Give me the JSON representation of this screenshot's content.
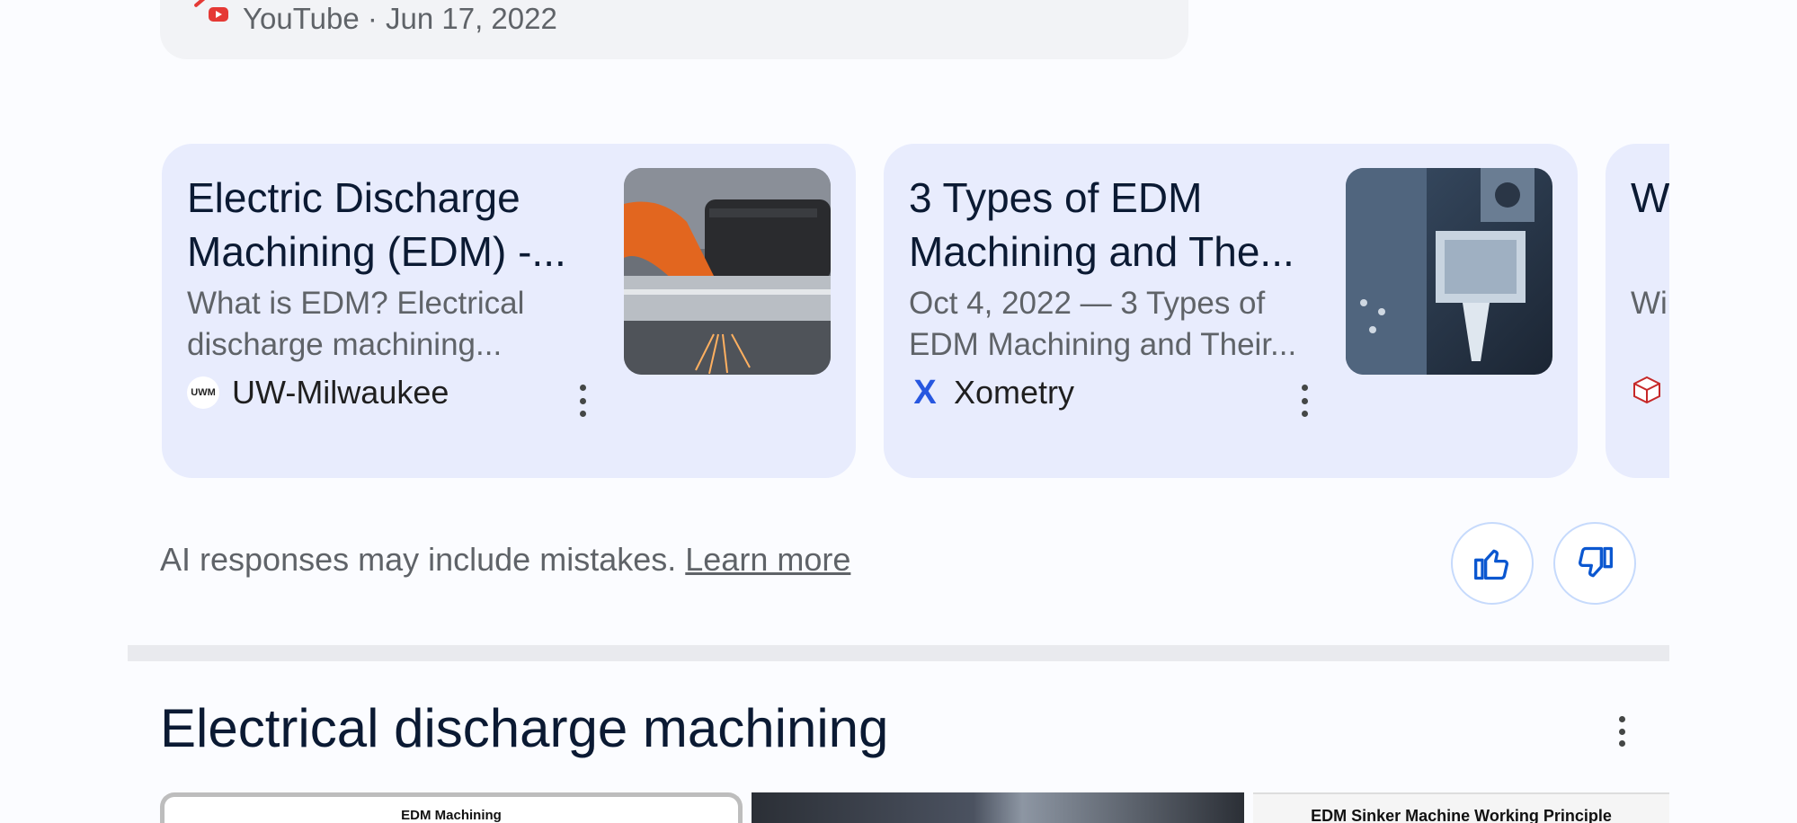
{
  "video": {
    "source": "YouTube",
    "date": "Jun 17, 2022",
    "meta": "YouTube · Jun 17, 2022"
  },
  "cards": [
    {
      "title": "Electric Discharge Machining (EDM) -...",
      "snippet": "What is EDM? Electrical discharge machining...",
      "source": "UW-Milwaukee",
      "source_icon": "UWM"
    },
    {
      "title": "3 Types of EDM Machining and The...",
      "snippet": "Oct 4, 2022 — 3 Types of EDM Machining and Their...",
      "source": "Xometry",
      "source_icon": "X"
    },
    {
      "title": "W Di",
      "snippet": "Wi as",
      "source": "",
      "source_icon": "cube-icon"
    }
  ],
  "disclaimer": {
    "text": "AI responses may include mistakes.",
    "link": "Learn more"
  },
  "section": {
    "title": "Electrical discharge machining"
  },
  "images": [
    {
      "caption": "EDM Machining"
    },
    {
      "caption": ""
    },
    {
      "caption": "EDM Sinker Machine Working Principle"
    }
  ],
  "colors": {
    "card_bg": "#e8ecfd",
    "page_bg": "#fbfcff",
    "title": "#0b1a33",
    "muted": "#5f6368",
    "xometry_blue": "#2757e0"
  }
}
